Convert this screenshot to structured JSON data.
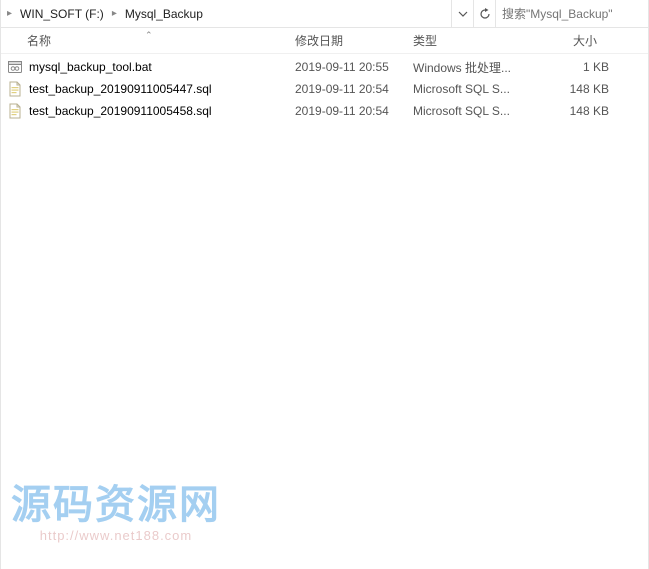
{
  "breadcrumb": {
    "items": [
      {
        "label": "WIN_SOFT (F:)"
      },
      {
        "label": "Mysql_Backup"
      }
    ]
  },
  "search": {
    "placeholder": "搜索\"Mysql_Backup\""
  },
  "columns": {
    "name": "名称",
    "date": "修改日期",
    "type": "类型",
    "size": "大小"
  },
  "files": [
    {
      "icon": "bat",
      "name": "mysql_backup_tool.bat",
      "date": "2019-09-11 20:55",
      "type": "Windows 批处理...",
      "size": "1 KB"
    },
    {
      "icon": "sql",
      "name": "test_backup_20190911005447.sql",
      "date": "2019-09-11 20:54",
      "type": "Microsoft SQL S...",
      "size": "148 KB"
    },
    {
      "icon": "sql",
      "name": "test_backup_20190911005458.sql",
      "date": "2019-09-11 20:54",
      "type": "Microsoft SQL S...",
      "size": "148 KB"
    }
  ],
  "watermark": {
    "title": "源码资源网",
    "url": "http://www.net188.com"
  }
}
